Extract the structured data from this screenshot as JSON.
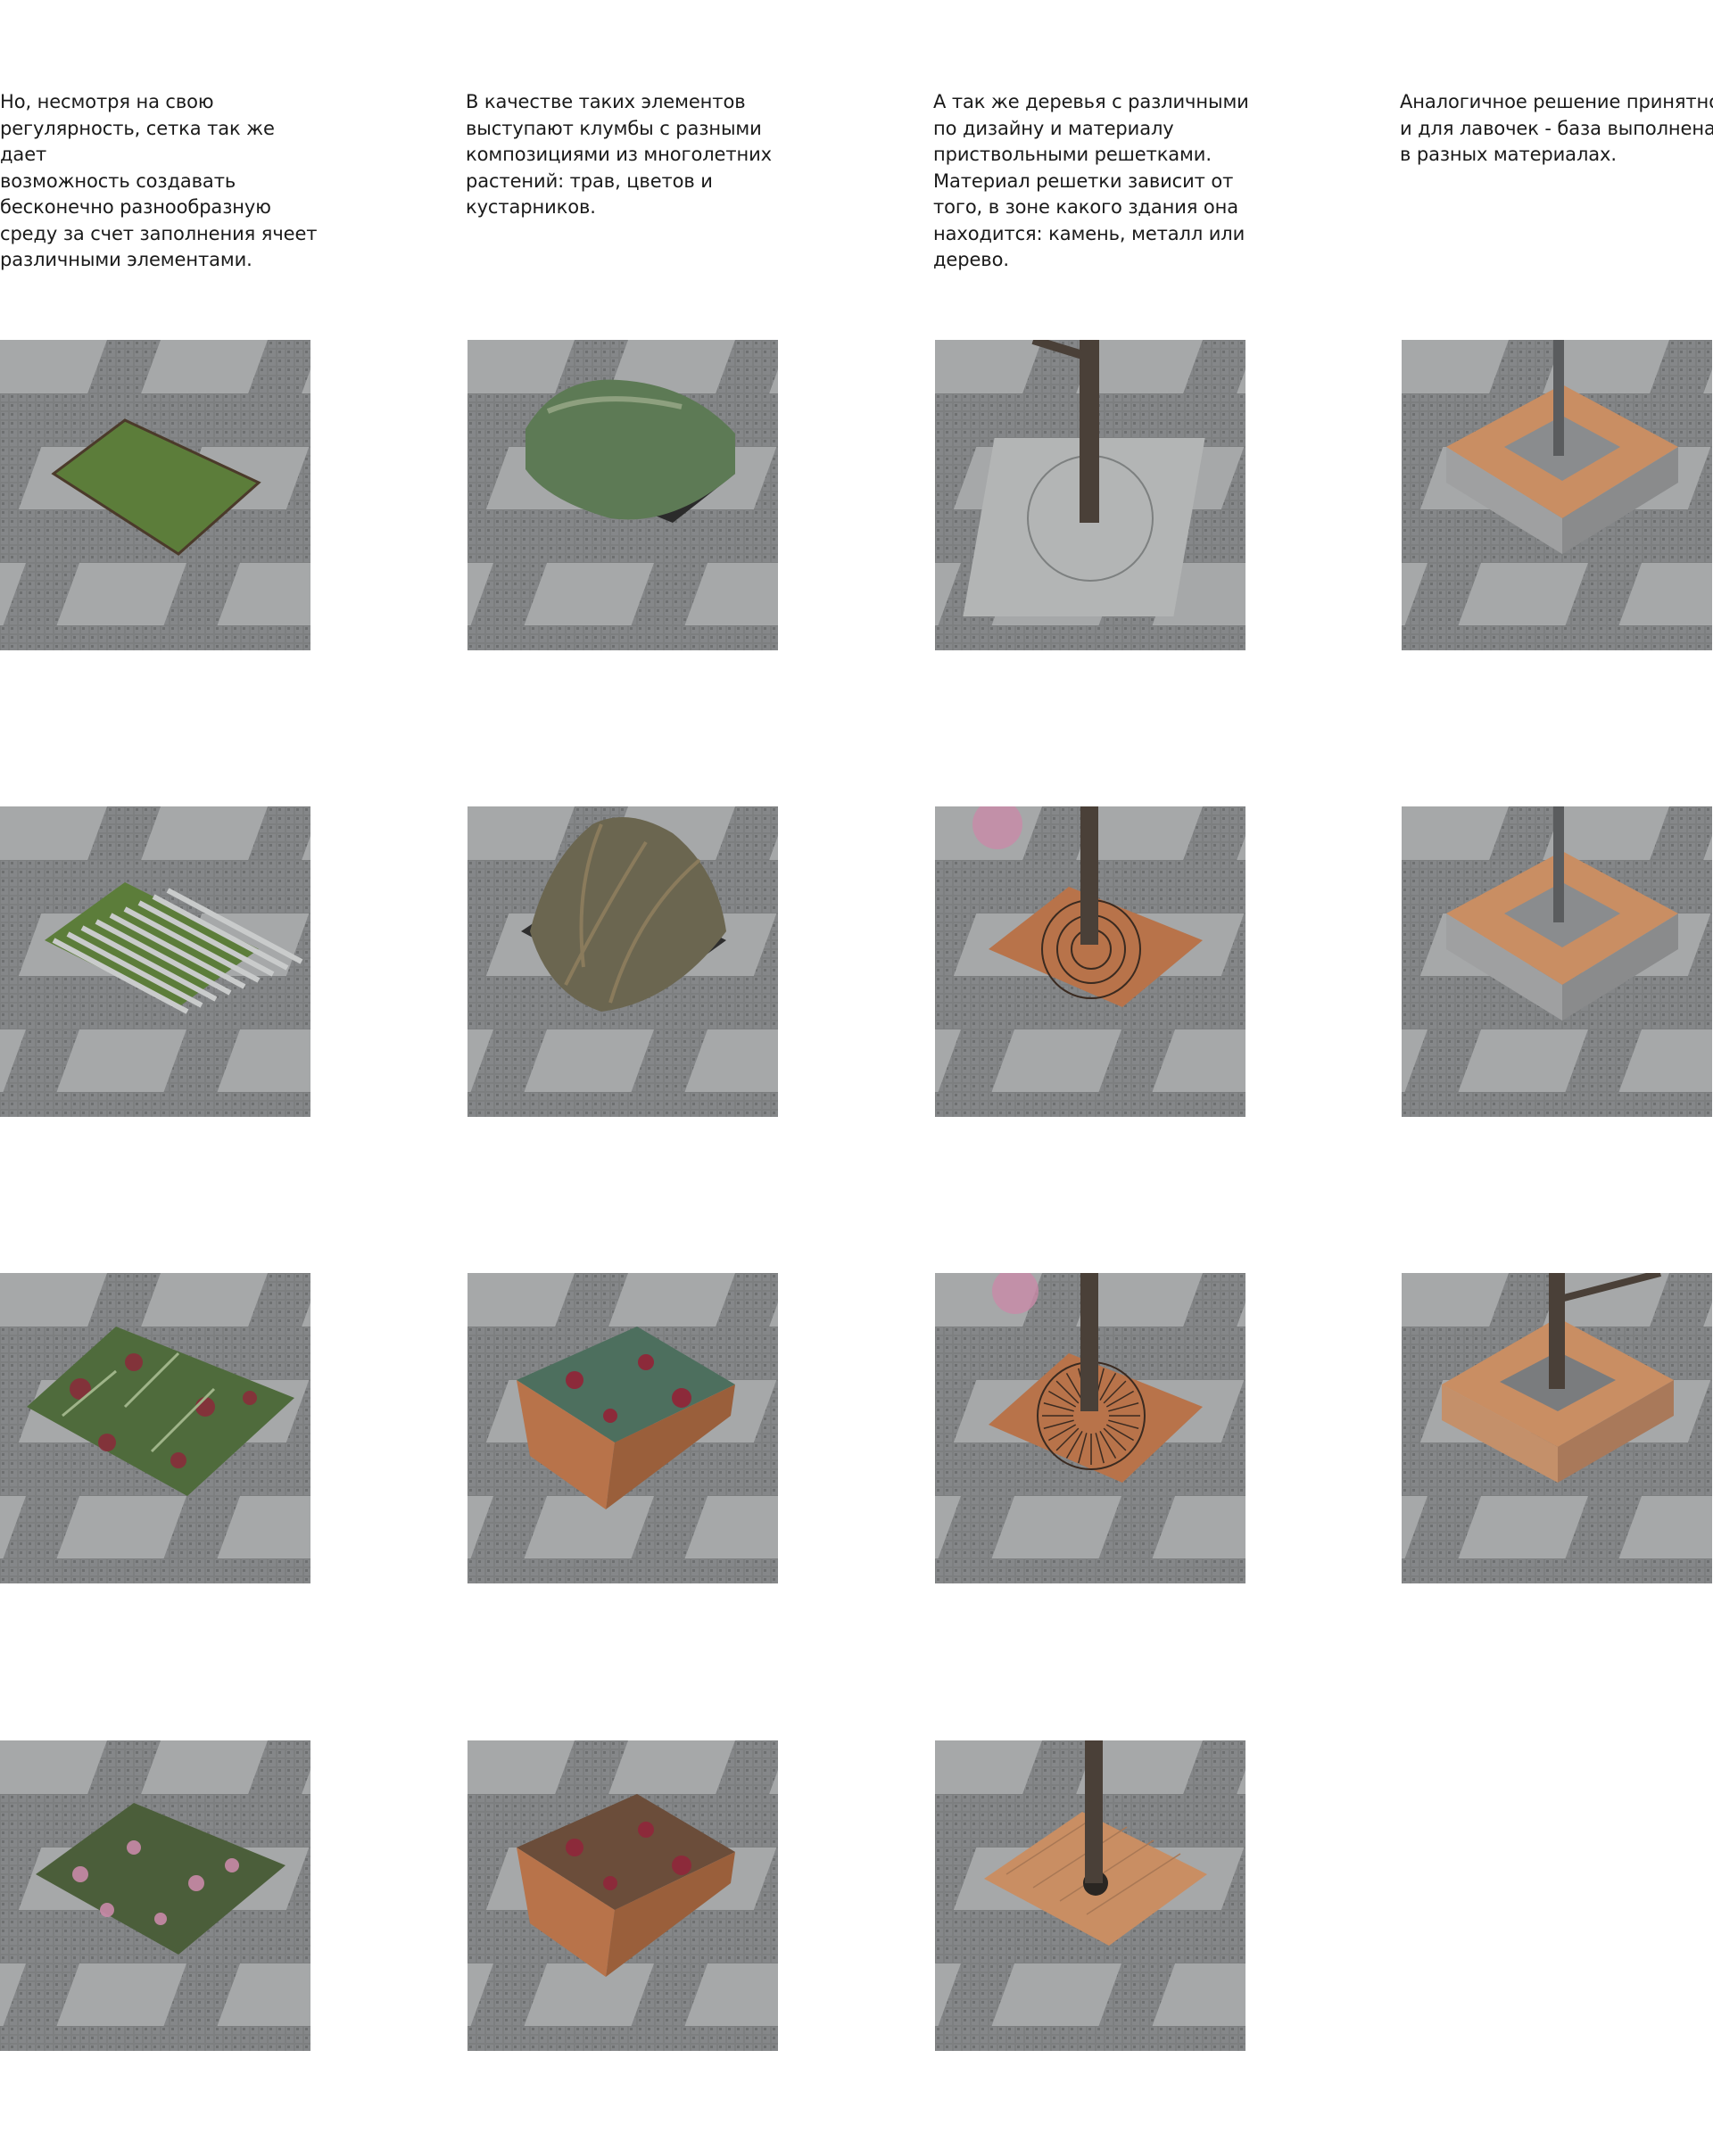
{
  "columns": [
    {
      "text": "Но, несмотря на свою\nрегулярность, сетка так же дает\nвозможность создавать\nбесконечно разнообразную\nсреду за счет заполнения ячеет\nразличными элементами."
    },
    {
      "text": "В качестве таких элементов\nвыступают клумбы с разными\nкомпозициями из многолетних\nрастений: трав, цветов и\nкустарников."
    },
    {
      "text": "А так же деревья с различными\nпо дизайну и материалу\nприствольными решетками.\nМатериал решетки зависит от\nтого, в зоне какого здания она\nнаходится: камень, металл или\nдерево."
    },
    {
      "text": "Аналогичное решение принятно\nи для лавочек - база выполнена\nв разных материалах."
    }
  ],
  "tiles": [
    {
      "name": "lawn-bed-tile",
      "kind": "lawn",
      "col": 0,
      "row": 0
    },
    {
      "name": "hedge-shrub-tile",
      "kind": "hedge",
      "col": 1,
      "row": 0
    },
    {
      "name": "tree-stone-grate-tile",
      "kind": "tree-stone",
      "col": 2,
      "row": 0
    },
    {
      "name": "bench-pole-tile-1",
      "kind": "bench-pole",
      "col": 3,
      "row": 0
    },
    {
      "name": "striped-grass-tile",
      "kind": "stripes",
      "col": 0,
      "row": 1
    },
    {
      "name": "ornamental-grass-tile",
      "kind": "grass",
      "col": 1,
      "row": 1
    },
    {
      "name": "tree-metal-rings-grate-tile",
      "kind": "tree-rings",
      "col": 2,
      "row": 1
    },
    {
      "name": "bench-pole-tile-2",
      "kind": "bench-pole",
      "col": 3,
      "row": 1
    },
    {
      "name": "fern-flower-bed-tile",
      "kind": "ferns",
      "col": 0,
      "row": 2
    },
    {
      "name": "raised-flower-bed-tile",
      "kind": "raised",
      "col": 1,
      "row": 2
    },
    {
      "name": "tree-metal-rays-grate-tile",
      "kind": "tree-rays",
      "col": 2,
      "row": 2
    },
    {
      "name": "bench-tree-tile",
      "kind": "bench-tree",
      "col": 3,
      "row": 2
    },
    {
      "name": "mixed-flower-bed-tile",
      "kind": "flowers",
      "col": 0,
      "row": 3
    },
    {
      "name": "raised-flower-bed-tile-2",
      "kind": "raised2",
      "col": 1,
      "row": 3
    },
    {
      "name": "tree-wood-grate-tile",
      "kind": "tree-wood",
      "col": 2,
      "row": 3
    }
  ],
  "palette": {
    "paving": "#7d7f80",
    "slab": "#a6a8a9",
    "grass": "#5c7d3a",
    "hedge": "#5d7a55",
    "stone_grate": "#b3b5b5",
    "corten": "#b8734a",
    "wood": "#c98e63",
    "bark": "#4a4038",
    "blossom": "#c98aa8",
    "flower_red": "#8c2a3a"
  }
}
